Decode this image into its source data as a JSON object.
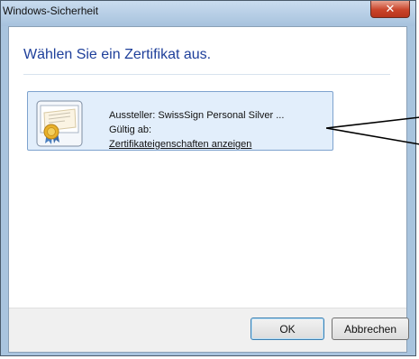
{
  "window": {
    "title": "Windows-Sicherheit",
    "close_symbol": "✕"
  },
  "dialog": {
    "heading": "Wählen Sie ein Zertifikat aus."
  },
  "certificate": {
    "icon": "certificate-icon",
    "issuer": "Aussteller: SwissSign Personal Silver ...",
    "valid_from": "Gültig ab:",
    "properties_link": "Zertifikateigenschaften anzeigen"
  },
  "buttons": {
    "ok": "OK",
    "cancel": "Abbrechen"
  },
  "colors": {
    "heading": "#1e3f9a",
    "selection_bg": "#e2eefb",
    "selection_border": "#7da2ce",
    "close_button": "#c9442a"
  }
}
